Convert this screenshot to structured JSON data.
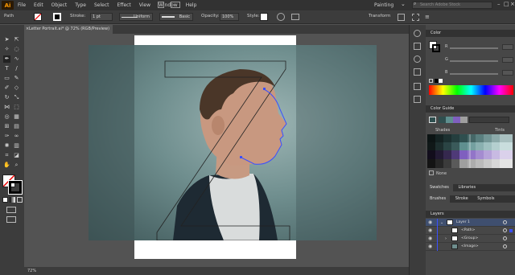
{
  "app": {
    "logo": "Ai",
    "workspace": "Painting",
    "search_placeholder": "Search Adobe Stock"
  },
  "menu": [
    "File",
    "Edit",
    "Object",
    "Type",
    "Select",
    "Effect",
    "View",
    "Window",
    "Help"
  ],
  "control": {
    "selection_label": "Path",
    "stroke_label": "Stroke:",
    "stroke_weight": "1 pt",
    "profile": "Uniform",
    "brush": "Basic",
    "opacity_label": "Opacity:",
    "opacity_value": "100%",
    "style_label": "Style:",
    "transform_label": "Transform"
  },
  "document": {
    "tab_title": "Letter Portrait.ai* @ 72% (RGB/Preview)",
    "close_glyph": "×",
    "zoom": "72%"
  },
  "color_panel": {
    "title": "Color",
    "channels": [
      "R",
      "G",
      "B"
    ]
  },
  "guide_panel": {
    "title": "Color Guide",
    "shades_label": "Shades",
    "tints_label": "Tints",
    "none_label": "None"
  },
  "swatch_tabs": [
    "Swatches",
    "Libraries"
  ],
  "brush_tabs": [
    "Brushes",
    "Stroke",
    "Symbols"
  ],
  "layers_panel": {
    "title": "Layers",
    "rows": [
      {
        "name": "Layer 1",
        "indent": 0
      },
      {
        "name": "<Path>",
        "indent": 1
      },
      {
        "name": "<Group>",
        "indent": 1
      },
      {
        "name": "<Image>",
        "indent": 1
      }
    ]
  },
  "colors": {
    "accent": "#ff9a00",
    "selection": "#3b4fff",
    "guide_base": [
      "#2f4f4f",
      "#5f8f8f",
      "#7f5fbf",
      "#9f9f9f"
    ]
  }
}
